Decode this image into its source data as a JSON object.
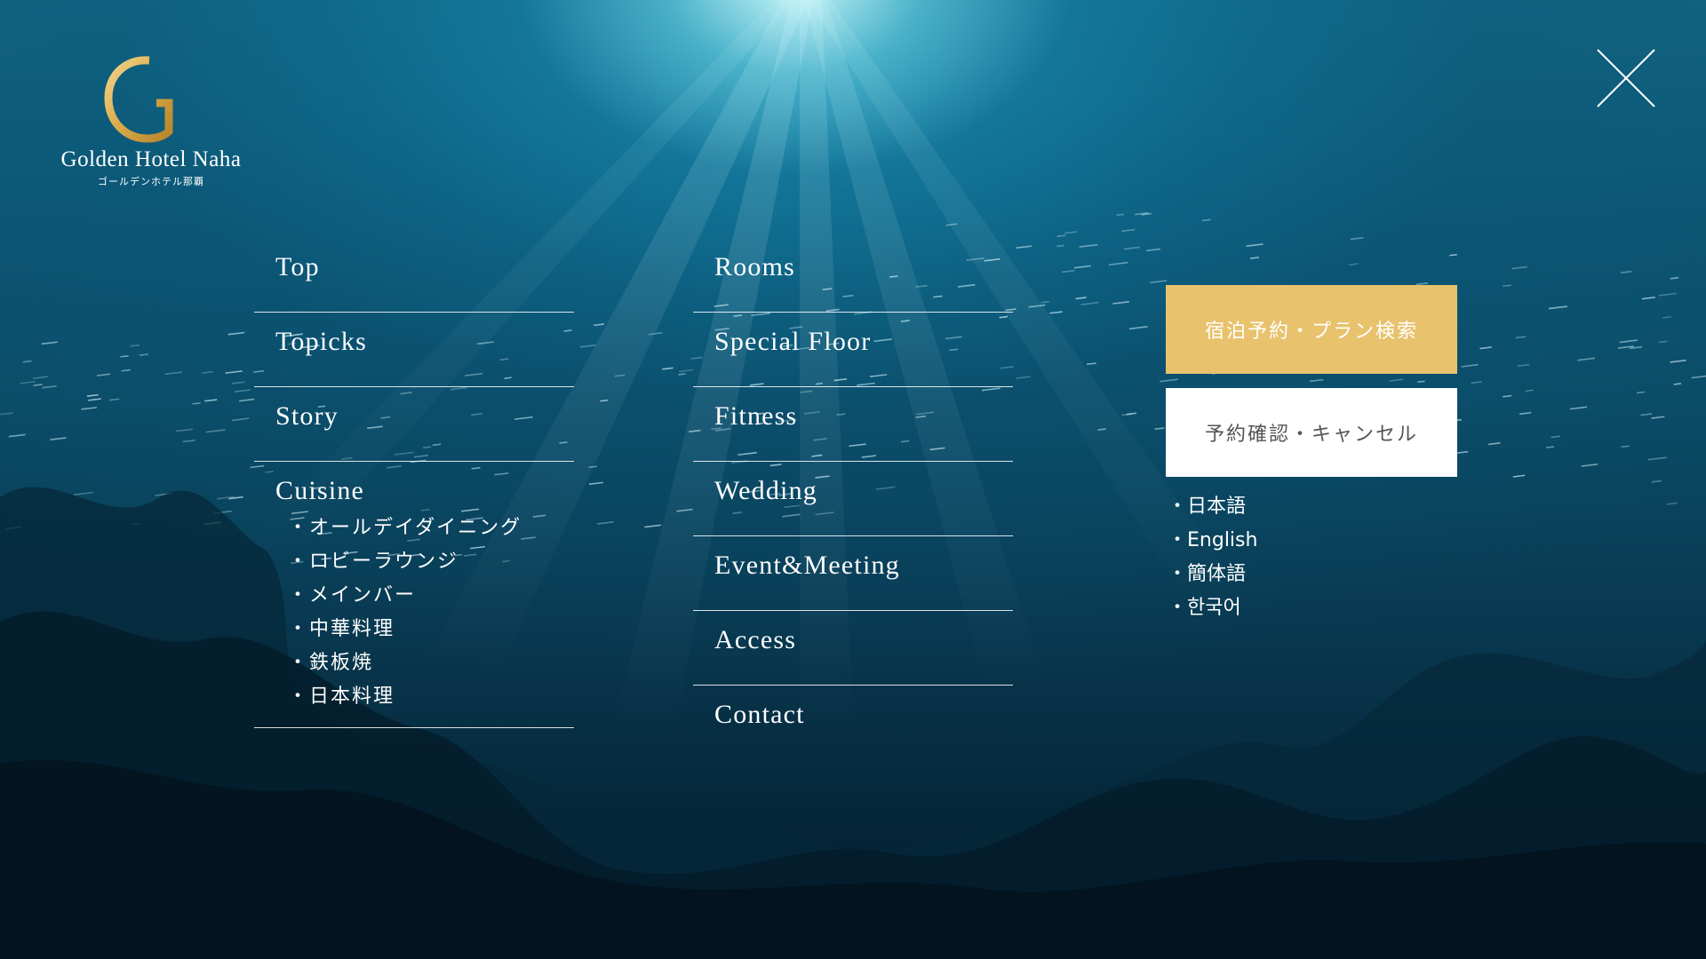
{
  "logo": {
    "name": "Golden Hotel Naha",
    "subname": "ゴールデンホテル那覇",
    "mark_color": "#d9ab4a"
  },
  "menu_left": {
    "items": [
      {
        "label": "Top"
      },
      {
        "label": "Topicks"
      },
      {
        "label": "Story"
      }
    ],
    "cuisine": {
      "label": "Cuisine",
      "subitems": [
        "オールデイダイニング",
        "ロビーラウンジ",
        "メインバー",
        "中華料理",
        "鉄板焼",
        "日本料理"
      ]
    }
  },
  "menu_mid": {
    "items": [
      {
        "label": "Rooms"
      },
      {
        "label": "Special Floor"
      },
      {
        "label": "Fitness"
      },
      {
        "label": "Wedding"
      },
      {
        "label": "Event&Meeting"
      },
      {
        "label": "Access"
      },
      {
        "label": "Contact"
      }
    ]
  },
  "booking": {
    "book_label": "宿泊予約・プラン検索",
    "book_color": "#e8c26c",
    "confirm_label": "予約確認・キャンセル"
  },
  "languages": [
    "日本語",
    "English",
    "簡体語",
    "한국어"
  ]
}
